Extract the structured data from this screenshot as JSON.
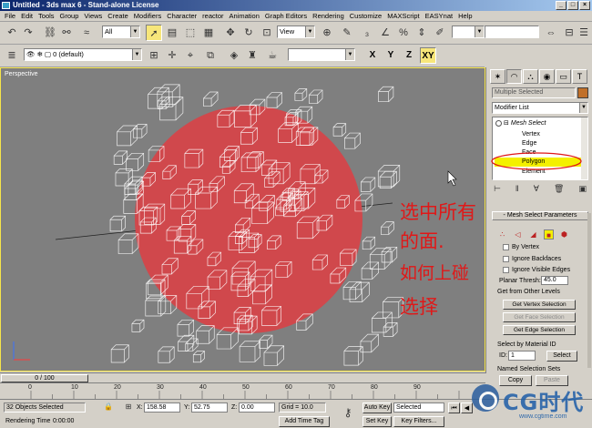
{
  "window": {
    "title": "Untitled - 3ds max 6 - Stand-alone License",
    "controls": [
      "_",
      "□",
      "×"
    ]
  },
  "menu": [
    "File",
    "Edit",
    "Tools",
    "Group",
    "Views",
    "Create",
    "Modifiers",
    "Character",
    "reactor",
    "Animation",
    "Graph Editors",
    "Rendering",
    "Customize",
    "MAXScript",
    "EASYnat",
    "Help"
  ],
  "toolbar": {
    "selection_filter": "All",
    "reference_coord": "View",
    "layer": "0 (default)",
    "axis_x": "X",
    "axis_y": "Y",
    "axis_z": "Z",
    "axis_xy": "XY"
  },
  "viewport": {
    "label": "Perspective",
    "annotation_lines": [
      "选中所有",
      "的面.",
      "如何上碰",
      "选择"
    ],
    "sphere_color": "#d0484c"
  },
  "command_panel": {
    "object_name": "Multiple Selected",
    "object_color": "#c0702a",
    "modifier_list": "Modifier List",
    "stack": {
      "modifier": "Mesh Select",
      "levels": [
        "Vertex",
        "Edge",
        "Face",
        "Polygon",
        "Element"
      ],
      "selected_level": "Polygon"
    },
    "rollout_title": "Mesh Select Parameters",
    "by_vertex": "By Vertex",
    "ignore_backfaces": "Ignore Backfaces",
    "ignore_visible_edges": "Ignore Visible Edges",
    "planar_thresh_label": "Planar Thresh:",
    "planar_thresh_value": "45.0",
    "get_from_other_levels": "Get from Other Levels",
    "get_vertex_selection": "Get Vertex Selection",
    "get_face_selection": "Get Face Selection",
    "get_edge_selection": "Get Edge Selection",
    "select_by_material_id": "Select by Material ID",
    "id_label": "ID:",
    "id_value": "1",
    "select_button": "Select",
    "named_selection_sets": "Named Selection Sets",
    "copy_button": "Copy",
    "paste_button": "Paste"
  },
  "timeline": {
    "slider": "0 / 100",
    "ticks": [
      "0",
      "10",
      "20",
      "30",
      "40",
      "50",
      "60",
      "70",
      "80",
      "90"
    ]
  },
  "status": {
    "objects_selected": "32 Objects Selected",
    "rendering_time_label": "Rendering Time",
    "rendering_time_value": "0:00:00",
    "x_label": "X:",
    "x_value": "158.58",
    "y_label": "Y:",
    "y_value": "52.75",
    "z_label": "Z:",
    "z_value": "0.00",
    "grid": "Grid = 10.0",
    "add_time_tag": "Add Time Tag",
    "auto_key": "Auto Key",
    "set_key": "Set Key",
    "selected": "Selected",
    "key_filters": "Key Filters..."
  },
  "watermark": {
    "text": "CG时代",
    "url": "www.cgtime.com"
  }
}
